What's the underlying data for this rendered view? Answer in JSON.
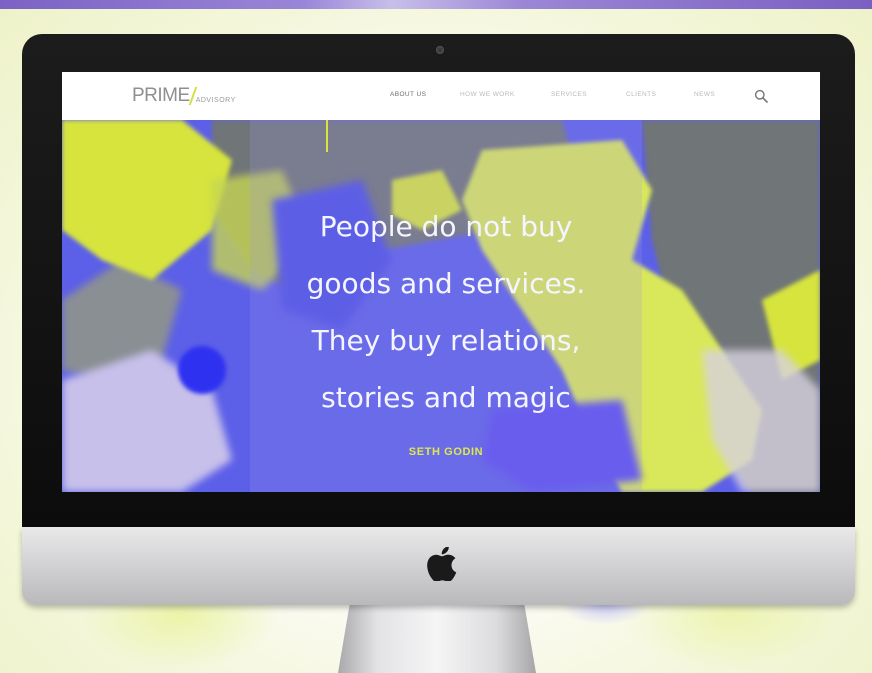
{
  "brand": {
    "main": "PRIME",
    "sub": "ADVISORY",
    "accent_color": "#d6e43c"
  },
  "nav": {
    "items": [
      {
        "label": "ABOUT US",
        "active": true
      },
      {
        "label": "HOW WE WORK",
        "active": false
      },
      {
        "label": "SERVICES",
        "active": false
      },
      {
        "label": "CLIENTS",
        "active": false
      },
      {
        "label": "NEWS",
        "active": false
      }
    ],
    "search_icon": "search-icon"
  },
  "hero": {
    "quote_lines": [
      "People do not buy",
      "goods and services.",
      "They buy relations,",
      "stories and magic"
    ],
    "author": "SETH GODIN",
    "colors": {
      "blue": "#5c5fe8",
      "lime": "#d6e43c",
      "gray": "#6f7478"
    }
  },
  "device": {
    "logo_icon": "apple-icon"
  }
}
